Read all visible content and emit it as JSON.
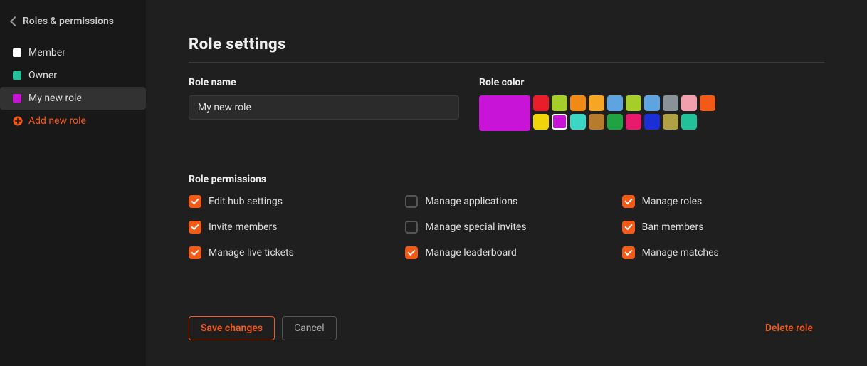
{
  "sidebar": {
    "title": "Roles & permissions",
    "roles": [
      {
        "label": "Member",
        "color": "#ffffff",
        "active": false
      },
      {
        "label": "Owner",
        "color": "#22c19a",
        "active": false
      },
      {
        "label": "My new role",
        "color": "#c814d6",
        "active": true
      }
    ],
    "add_label": "Add new role"
  },
  "page": {
    "title": "Role settings",
    "role_name_label": "Role name",
    "role_name_value": "My new role",
    "role_color_label": "Role color",
    "preview_color": "#c814d6",
    "color_row1": [
      "#e91e2a",
      "#a6ce2a",
      "#f08a15",
      "#f6a623",
      "#5ea4e0",
      "#a6ce2a",
      "#5ea4e0",
      "#889298",
      "#f2a0ad",
      "#f25a18"
    ],
    "color_row2": [
      "#f2d40b",
      "#c814d6",
      "#3cd6c5",
      "#b77b2d",
      "#1fa343",
      "#e71a6b",
      "#1a2fd6",
      "#b0a244",
      "#22c19a"
    ],
    "selected_color": "#c814d6",
    "perms_title": "Role permissions",
    "permissions": [
      {
        "label": "Edit hub settings",
        "checked": true
      },
      {
        "label": "Manage applications",
        "checked": false
      },
      {
        "label": "Manage roles",
        "checked": true
      },
      {
        "label": "Invite members",
        "checked": true
      },
      {
        "label": "Manage special invites",
        "checked": false
      },
      {
        "label": "Ban members",
        "checked": true
      },
      {
        "label": "Manage live tickets",
        "checked": true
      },
      {
        "label": "Manage leaderboard",
        "checked": true
      },
      {
        "label": "Manage matches",
        "checked": true
      }
    ],
    "save_label": "Save changes",
    "cancel_label": "Cancel",
    "delete_label": "Delete role"
  }
}
